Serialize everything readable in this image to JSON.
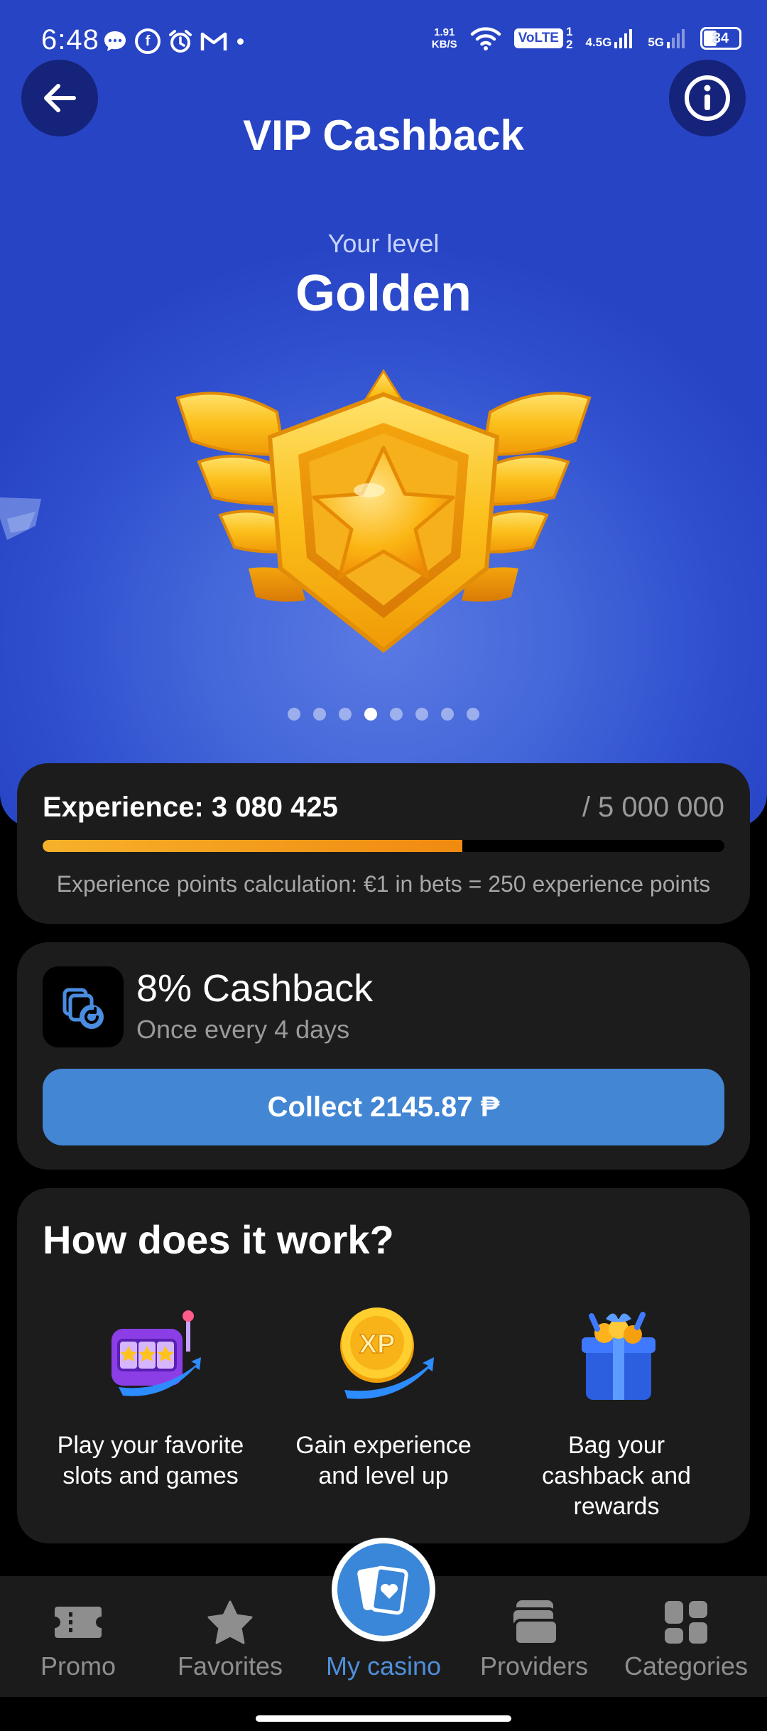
{
  "status_bar": {
    "time": "6:48",
    "notif_icons": [
      "chat-bubble-icon",
      "facebook-icon",
      "alarm-icon",
      "gmail-icon"
    ],
    "speed_value": "1.91",
    "speed_unit": "KB/S",
    "volte": "VoLTE",
    "sim1": "1",
    "sim2": "2",
    "net1": "4.5G",
    "net2": "5G",
    "battery": "34"
  },
  "header": {
    "title": "VIP Cashback"
  },
  "level": {
    "caption": "Your level",
    "name": "Golden",
    "carousel_count": 8,
    "carousel_active_index": 3
  },
  "experience": {
    "label": "Experience: 3 080 425",
    "max": "/ 5 000 000",
    "current": 3080425,
    "target": 5000000,
    "note": "Experience points calculation: €1 in bets = 250 experience points"
  },
  "cashback": {
    "title": "8% Cashback",
    "subtitle": "Once every 4 days",
    "collect_label": "Collect 2145.87 ₱"
  },
  "how": {
    "title": "How does it work?",
    "steps": [
      {
        "line1": "Play your favorite",
        "line2": "slots and games",
        "line3": ""
      },
      {
        "line1": "Gain experience",
        "line2": "and level up",
        "line3": ""
      },
      {
        "line1": "Bag your",
        "line2": "cashback and",
        "line3": "rewards"
      }
    ]
  },
  "nav": {
    "items": [
      {
        "label": "Promo"
      },
      {
        "label": "Favorites"
      },
      {
        "label": "My casino"
      },
      {
        "label": "Providers"
      },
      {
        "label": "Categories"
      }
    ],
    "active": "My casino"
  },
  "colors": {
    "hero_blue": "#2f4fcf",
    "accent_blue": "#4286d4",
    "progress_orange": "#f5a31d",
    "card_bg": "#1c1c1c"
  }
}
